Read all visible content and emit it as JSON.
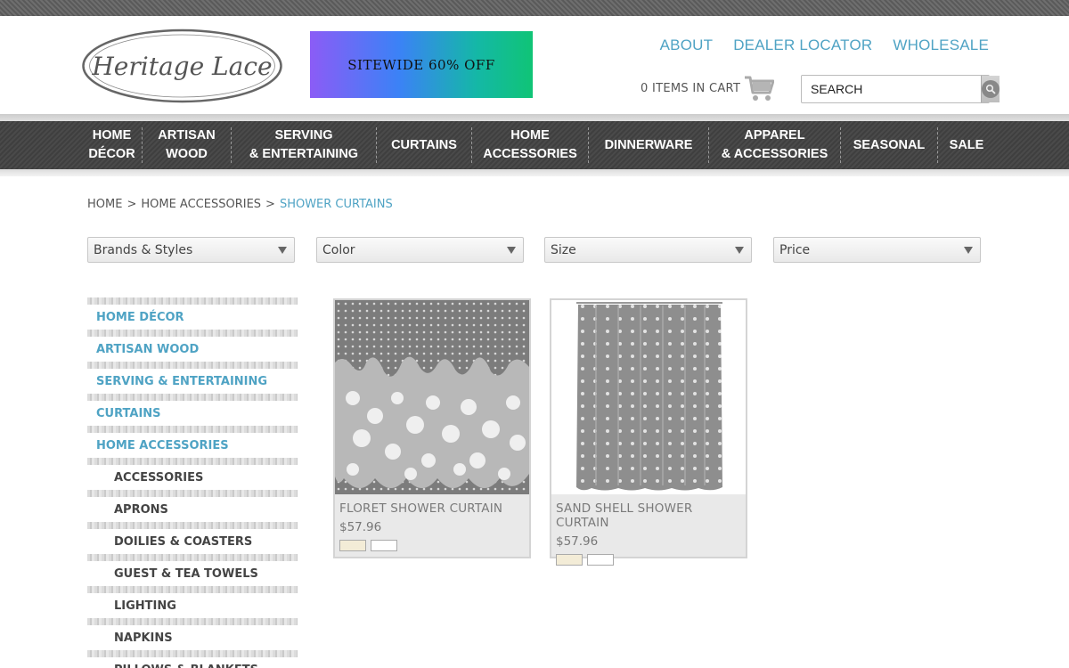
{
  "brand": {
    "logo_text": "Heritage Lace"
  },
  "banner": {
    "text": "SITEWIDE 60% OFF"
  },
  "top_links": [
    "ABOUT",
    "DEALER LOCATOR",
    "WHOLESALE"
  ],
  "cart": {
    "text": "0 ITEMS IN CART"
  },
  "search": {
    "placeholder": "SEARCH"
  },
  "nav": [
    "HOME\nDÉCOR",
    "ARTISAN\nWOOD",
    "SERVING\n& ENTERTAINING",
    "CURTAINS",
    "HOME\nACCESSORIES",
    "DINNERWARE",
    "APPAREL\n& ACCESSORIES",
    "SEASONAL",
    "SALE"
  ],
  "breadcrumb": {
    "home": "HOME",
    "sep1": ">",
    "parent": "HOME ACCESSORIES",
    "sep2": ">",
    "current": "SHOWER CURTAINS"
  },
  "filters": [
    "Brands & Styles",
    "Color",
    "Size",
    "Price"
  ],
  "sidebar": {
    "categories": [
      "HOME DÉCOR",
      "ARTISAN WOOD",
      "SERVING & ENTERTAINING",
      "CURTAINS",
      "HOME ACCESSORIES"
    ],
    "subcategories": [
      "ACCESSORIES",
      "APRONS",
      "DOILIES & COASTERS",
      "GUEST & TEA TOWELS",
      "LIGHTING",
      "NAPKINS",
      "PILLOWS & BLANKETS"
    ]
  },
  "products": [
    {
      "name": "FLORET SHOWER CURTAIN",
      "price": "$57.96",
      "swatches": [
        "#f3ecd7",
        "#ffffff"
      ]
    },
    {
      "name": "SAND SHELL SHOWER CURTAIN",
      "price": "$57.96",
      "swatches": [
        "#f3ecd7",
        "#ffffff"
      ]
    }
  ],
  "colors": {
    "accent": "#4fa3c4",
    "nav_bg": "#444444"
  }
}
